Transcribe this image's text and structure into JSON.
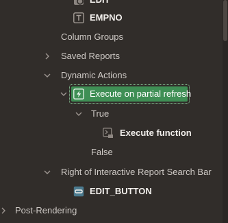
{
  "tree": {
    "nodes": [
      {
        "id": "edit",
        "label": "EDIT",
        "level": "item",
        "icon": "link-icon"
      },
      {
        "id": "empno",
        "label": "EMPNO",
        "level": "item",
        "icon": "text-field-icon"
      },
      {
        "id": "column-groups",
        "label": "Column Groups",
        "level": "section"
      },
      {
        "id": "saved-reports",
        "label": "Saved Reports",
        "level": "section",
        "toggle": "collapsed"
      },
      {
        "id": "dynamic-actions",
        "label": "Dynamic Actions",
        "level": "section",
        "toggle": "expanded"
      },
      {
        "id": "execute-partial-refresh",
        "label": "Execute on partial refresh",
        "level": "item",
        "icon": "lightning-icon",
        "toggle": "expanded",
        "selected": true
      },
      {
        "id": "true",
        "label": "True",
        "level": "subsection",
        "toggle": "expanded"
      },
      {
        "id": "execute-function",
        "label": "Execute function",
        "level": "item",
        "icon": "code-action-icon"
      },
      {
        "id": "false",
        "label": "False",
        "level": "subsection"
      },
      {
        "id": "right-of-ir-search",
        "label": "Right of Interactive Report Search Bar",
        "level": "section",
        "toggle": "expanded"
      },
      {
        "id": "edit-button",
        "label": "EDIT_BUTTON",
        "level": "item",
        "icon": "button-icon"
      },
      {
        "id": "post-rendering",
        "label": "Post-Rendering",
        "level": "root",
        "toggle": "collapsed"
      }
    ]
  },
  "colors": {
    "background": "#312d2a",
    "selected": "#3f8f55",
    "selected_outline": "#8fd3a0",
    "text": "#d6d2cf",
    "text_strong": "#f2efec"
  }
}
